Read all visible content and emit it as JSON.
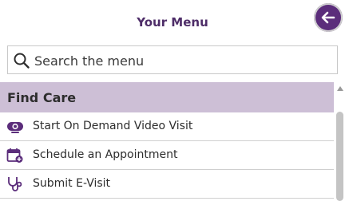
{
  "header": {
    "title": "Your Menu",
    "back_icon": "arrow-left-icon"
  },
  "search": {
    "placeholder": "Search the menu",
    "value": "",
    "icon": "search-icon"
  },
  "section": {
    "title": "Find Care",
    "items": [
      {
        "label": "Start On Demand Video Visit",
        "icon": "video-camera-icon"
      },
      {
        "label": "Schedule an Appointment",
        "icon": "calendar-add-icon"
      },
      {
        "label": "Submit E-Visit",
        "icon": "stethoscope-icon"
      }
    ]
  },
  "colors": {
    "accent": "#5b2d7b",
    "title": "#4e2d68",
    "section_bg": "#cdbfd6"
  }
}
